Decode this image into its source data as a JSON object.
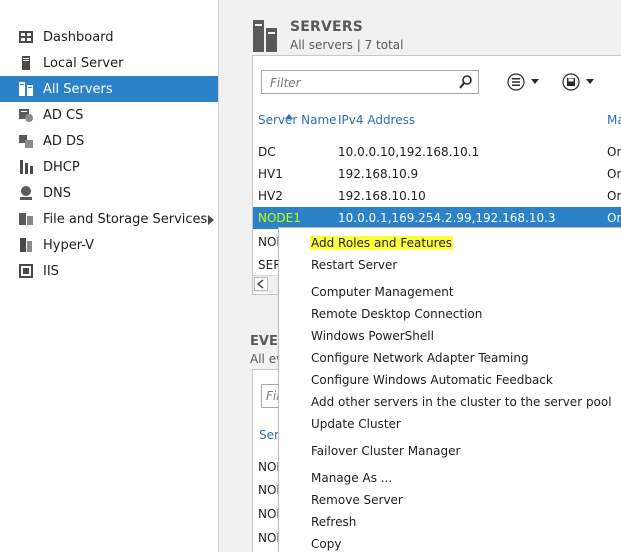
{
  "sidebar": {
    "items": [
      {
        "label": "Dashboard",
        "icon": "dashboard-icon"
      },
      {
        "label": "Local Server",
        "icon": "local-server-icon"
      },
      {
        "label": "All Servers",
        "icon": "all-servers-icon",
        "selected": true
      },
      {
        "label": "AD CS",
        "icon": "ad-cs-icon"
      },
      {
        "label": "AD DS",
        "icon": "ad-ds-icon"
      },
      {
        "label": "DHCP",
        "icon": "dhcp-icon"
      },
      {
        "label": "DNS",
        "icon": "dns-icon"
      },
      {
        "label": "File and Storage Services",
        "icon": "file-storage-icon",
        "has_submenu": true
      },
      {
        "label": "Hyper-V",
        "icon": "hyper-v-icon"
      },
      {
        "label": "IIS",
        "icon": "iis-icon"
      }
    ]
  },
  "servers": {
    "title": "SERVERS",
    "subtitle": "All servers | 7 total",
    "filter_placeholder": "Filter",
    "columns": [
      "Server Name",
      "IPv4 Address",
      "Ma"
    ],
    "rows": [
      {
        "name": "DC",
        "ip": "10.0.0.10,192.168.10.1",
        "m": "On"
      },
      {
        "name": "HV1",
        "ip": "192.168.10.9",
        "m": "On"
      },
      {
        "name": "HV2",
        "ip": "192.168.10.10",
        "m": "On"
      },
      {
        "name": "NODE1",
        "ip": "10.0.0.1,169.254.2.99,192.168.10.3",
        "m": "On",
        "selected": true
      },
      {
        "name": "NOI",
        "ip": "",
        "m": ""
      },
      {
        "name": "SER",
        "ip": "",
        "m": ""
      }
    ]
  },
  "events": {
    "title": "EVE",
    "subtitle": "All ev",
    "filter_placeholder": "Fil",
    "column": "Serv",
    "rows": [
      "NOI",
      "NOI",
      "NOI",
      "NOI"
    ]
  },
  "context_menu": {
    "items": [
      {
        "label": "Add Roles and Features",
        "highlight": true
      },
      {
        "label": "Restart Server"
      },
      {
        "label": "Computer Management"
      },
      {
        "label": "Remote Desktop Connection"
      },
      {
        "label": "Windows PowerShell"
      },
      {
        "label": "Configure Network Adapter Teaming"
      },
      {
        "label": "Configure Windows Automatic Feedback"
      },
      {
        "label": "Add other servers in the cluster to the server pool"
      },
      {
        "label": "Update Cluster"
      },
      {
        "label": "Failover Cluster Manager"
      },
      {
        "label": "Manage As ..."
      },
      {
        "label": "Remove Server"
      },
      {
        "label": "Refresh"
      },
      {
        "label": "Copy"
      }
    ]
  },
  "colors": {
    "accent": "#2b82c8",
    "selected_name": "#c8ff00",
    "highlight": "#ffff3a",
    "link": "#2b6fb5"
  }
}
